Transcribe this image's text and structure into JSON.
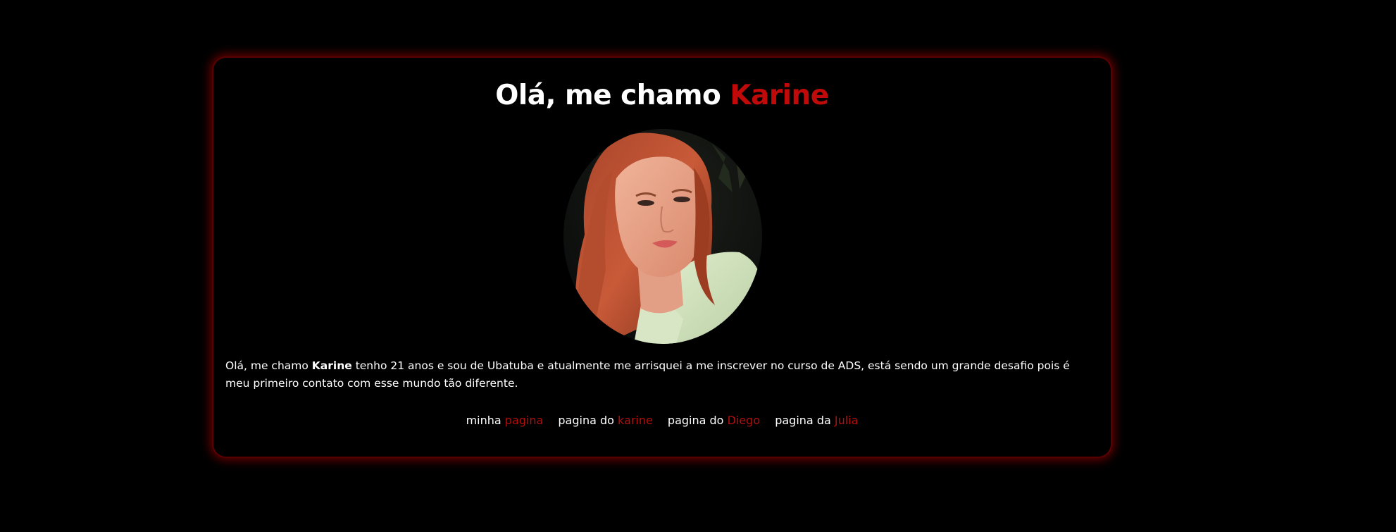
{
  "header": {
    "title_prefix": "Olá, me chamo",
    "title_name": "Karine"
  },
  "profile": {
    "photo_icon": "portrait-photo"
  },
  "bio": {
    "before_name": "Olá, me chamo ",
    "name": "Karine",
    "after_name": " tenho 21 anos e sou de Ubatuba e atualmente me arrisquei a me inscrever no curso de ADS, está sendo um grande desafio pois é meu primeiro contato com esse mundo tão diferente."
  },
  "links": [
    {
      "prefix": "minha",
      "accent": "pagina"
    },
    {
      "prefix": "pagina do",
      "accent": "karine"
    },
    {
      "prefix": "pagina do",
      "accent": "Diego"
    },
    {
      "prefix": "pagina da",
      "accent": "Julia"
    }
  ],
  "colors": {
    "background": "#000000",
    "text": "#ffffff",
    "accent": "#c00a0a",
    "glow": "#be0000"
  }
}
